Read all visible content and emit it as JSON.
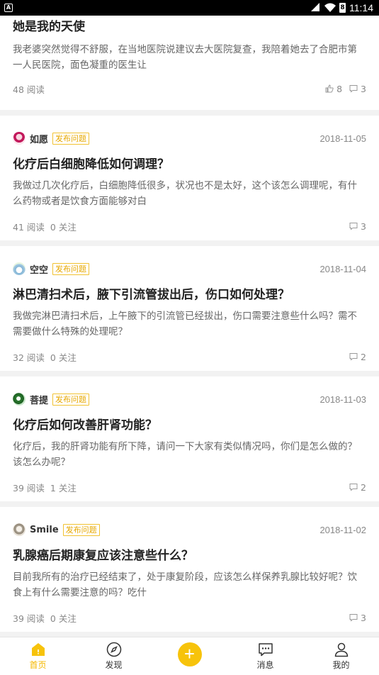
{
  "status_bar": {
    "time": "11:14",
    "battery": "8"
  },
  "posts": [
    {
      "title": "她是我的天使",
      "excerpt": "我老婆突然觉得不舒服，在当地医院说建议去大医院复查，我陪着她去了合肥市第一人民医院，面色凝重的医生让",
      "reads": "48 阅读",
      "likes": "8",
      "comments": "3"
    },
    {
      "author": "如愿",
      "tag": "发布问题",
      "date": "2018-11-05",
      "title": "化疗后白细胞降低如何调理？",
      "excerpt": "我做过几次化疗后，白细胞降低很多，状况也不是太好，这个该怎么调理呢，有什么药物或者是饮食方面能够对白",
      "reads": "41 阅读",
      "follows": "0 关注",
      "comments": "3",
      "avatar_color": "#c2185b"
    },
    {
      "author": "空空",
      "tag": "发布问题",
      "date": "2018-11-04",
      "title": "淋巴清扫术后，腋下引流管拔出后，伤口如何处理？",
      "excerpt": "我做完淋巴清扫术后，上午腋下的引流管已经拔出，伤口需要注意些什么吗？需不需要做什么特殊的处理呢？",
      "reads": "32 阅读",
      "follows": "0 关注",
      "comments": "2",
      "avatar_color": "#7fb3d5"
    },
    {
      "author": "菩提",
      "tag": "发布问题",
      "date": "2018-11-03",
      "title": "化疗后如何改善肝肾功能？",
      "excerpt": "化疗后，我的肝肾功能有所下降，请问一下大家有类似情况吗，你们是怎么做的？该怎么办呢？",
      "reads": "39 阅读",
      "follows": "1 关注",
      "comments": "2",
      "avatar_color": "#2e7d32"
    },
    {
      "author": "Smile",
      "tag": "发布问题",
      "date": "2018-11-02",
      "title": "乳腺癌后期康复应该注意些什么？",
      "excerpt": "目前我所有的治疗已经结束了，处于康复阶段，应该怎么样保养乳腺比较好呢？饮食上有什么需要注意的吗？吃什",
      "reads": "39 阅读",
      "follows": "0 关注",
      "comments": "3",
      "avatar_color": "#b0a89a"
    }
  ],
  "tabbar": {
    "home": "首页",
    "discover": "发现",
    "add": "+",
    "messages": "消息",
    "mine": "我的"
  },
  "colors": {
    "accent": "#f7c30b",
    "tag": "#e7a800"
  }
}
